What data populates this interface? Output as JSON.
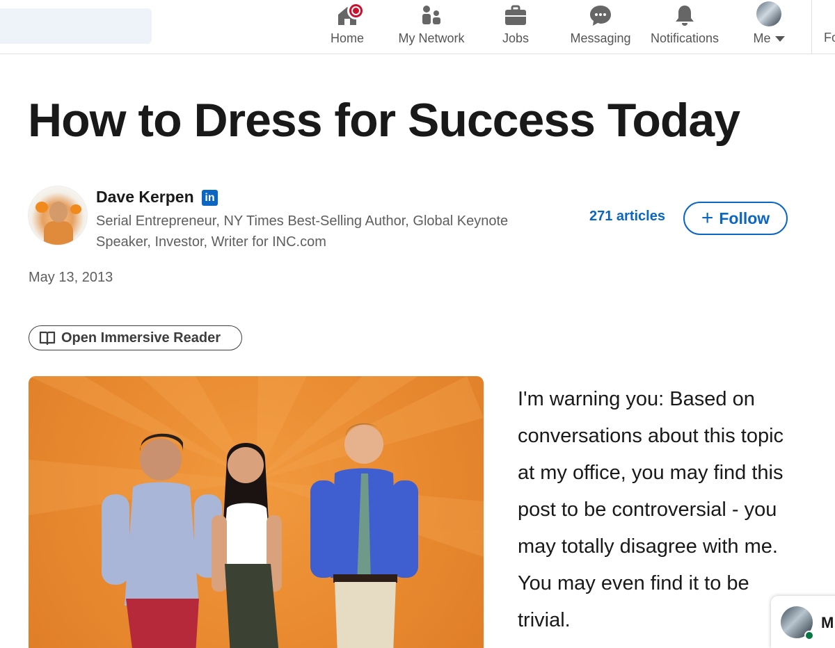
{
  "nav": {
    "items": [
      {
        "label": "Home",
        "icon": "home-icon",
        "badge": true
      },
      {
        "label": "My Network",
        "icon": "network-icon"
      },
      {
        "label": "Jobs",
        "icon": "jobs-icon"
      },
      {
        "label": "Messaging",
        "icon": "messaging-icon"
      },
      {
        "label": "Notifications",
        "icon": "notifications-icon"
      },
      {
        "label": "Me",
        "icon": "profile-avatar"
      }
    ],
    "more_label": "Fo"
  },
  "article": {
    "title": "How to Dress for Success Today",
    "author": {
      "name": "Dave Kerpen",
      "badge": "in",
      "headline": "Serial Entrepreneur, NY Times Best-Selling Author, Global Keynote Speaker, Investor, Writer for INC.com"
    },
    "articles_count": "271 articles",
    "follow_label": "Follow",
    "date": "May 13, 2013",
    "reader_label": "Open Immersive Reader",
    "body": "I'm warning you: Based on conversations about this topic at my office, you may find this post to be controversial - you may totally disagree with me. You may even find it to be trivial."
  },
  "messaging": {
    "label": "M"
  },
  "colors": {
    "brand": "#0a66c2",
    "badge": "#cb112d",
    "hero_bg": "#e98a30",
    "online": "#057642"
  }
}
